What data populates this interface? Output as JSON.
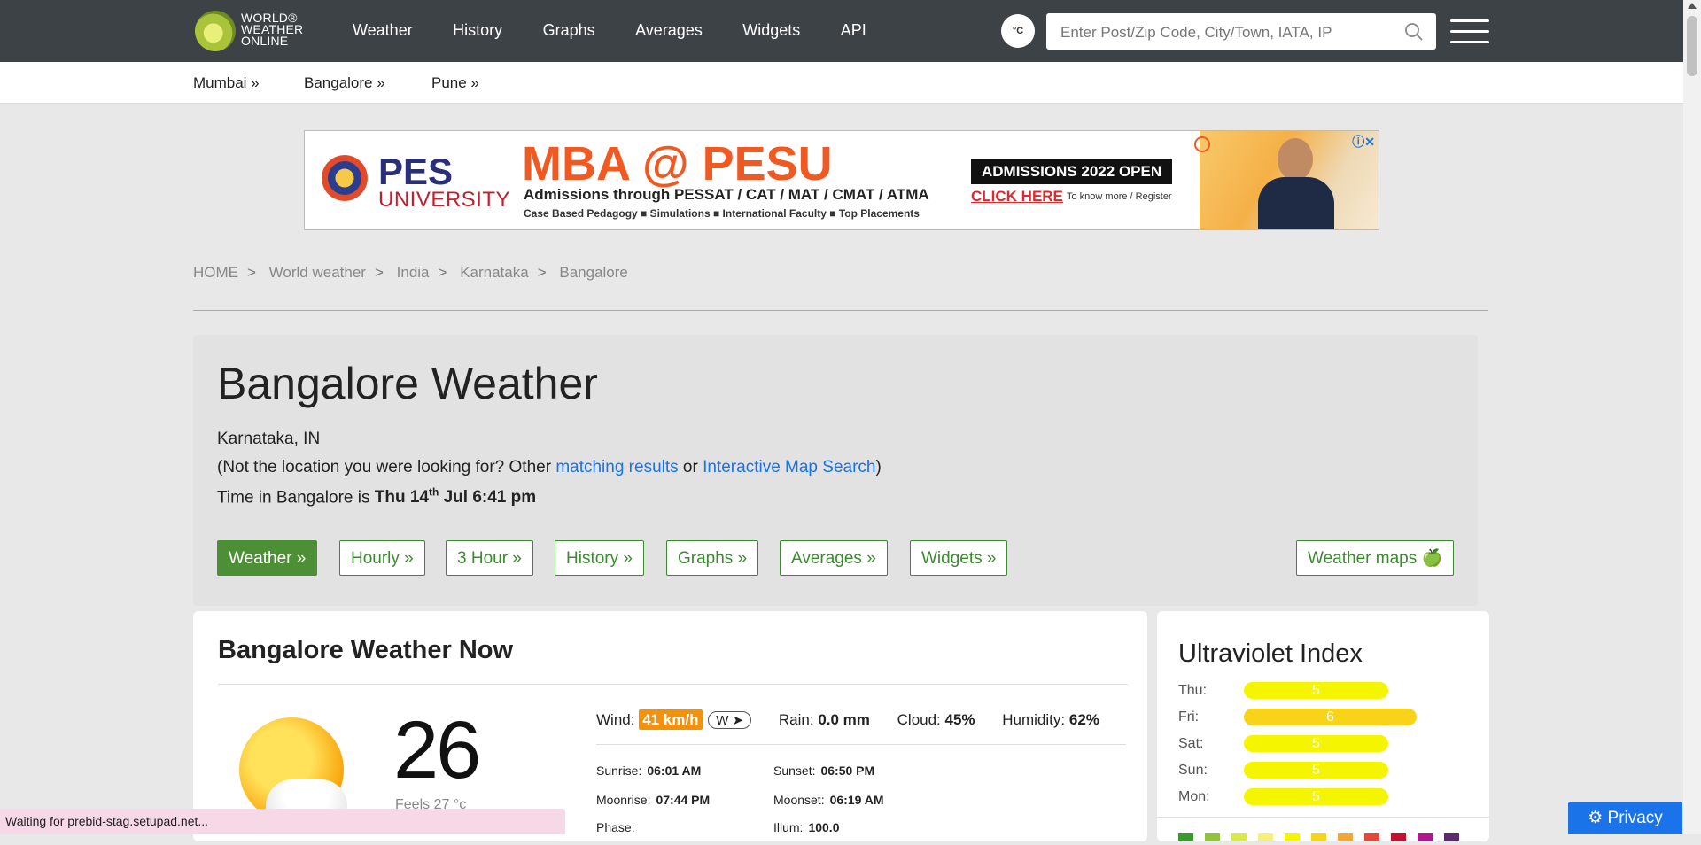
{
  "topbar": {
    "logo_lines": [
      "WORLD®",
      "WEATHER",
      "ONLINE"
    ],
    "nav": [
      "Weather",
      "History",
      "Graphs",
      "Averages",
      "Widgets",
      "API"
    ],
    "unit_label": "°C",
    "search_placeholder": "Enter Post/Zip Code, City/Town, IATA, IP"
  },
  "subnav": [
    "Mumbai »",
    "Bangalore »",
    "Pune »"
  ],
  "ad": {
    "brand": "PES",
    "brand_sub": "UNIVERSITY",
    "headline": "MBA @ PESU",
    "admissions": "Admissions through PESSAT / CAT / MAT / CMAT / ATMA",
    "features": "Case Based Pedagogy ■ Simulations ■ International Faculty ■ Top Placements",
    "open": "ADMISSIONS 2022 OPEN",
    "cta": "CLICK HERE",
    "cta_sub": "To know more / Register",
    "close": "ⓘ✕"
  },
  "breadcrumb": [
    "HOME",
    "World weather",
    "India",
    "Karnataka",
    "Bangalore"
  ],
  "header": {
    "title": "Bangalore Weather",
    "location": "Karnataka, IN",
    "not_location_prefix": "(Not the location you were looking for? Other ",
    "matching_link": "matching results",
    "or": " or ",
    "map_link": "Interactive Map Search",
    "close_paren": ")",
    "time_prefix": "Time in Bangalore is ",
    "time_day": "Thu 14",
    "time_sup": "th",
    "time_rest": " Jul 6:41 pm"
  },
  "tabs": [
    "Weather »",
    "Hourly »",
    "3 Hour »",
    "History »",
    "Graphs »",
    "Averages »",
    "Widgets »"
  ],
  "weather_maps_label": "Weather maps 🍏",
  "now": {
    "title": "Bangalore Weather Now",
    "temp": "26",
    "feels": "Feels 27 °c",
    "wind_label": "Wind:",
    "wind_speed": "41 km/h",
    "wind_dir": "W ➤",
    "rain_label": "Rain:",
    "rain": "0.0 mm",
    "cloud_label": "Cloud:",
    "cloud": "45%",
    "humidity_label": "Humidity:",
    "humidity": "62%",
    "sunrise_label": "Sunrise:",
    "sunrise": "06:01 AM",
    "sunset_label": "Sunset:",
    "sunset": "06:50 PM",
    "moonrise_label": "Moonrise:",
    "moonrise": "07:44 PM",
    "moonset_label": "Moonset:",
    "moonset": "06:19 AM",
    "phase_label": "Phase:",
    "illum_label": "Illum:",
    "illum": "100.0"
  },
  "uv": {
    "title": "Ultraviolet Index",
    "rows": [
      {
        "day": "Thu:",
        "value": "5",
        "color": "#f5f500"
      },
      {
        "day": "Fri:",
        "value": "6",
        "color": "#f9d31a"
      },
      {
        "day": "Sat:",
        "value": "5",
        "color": "#f5f500"
      },
      {
        "day": "Sun:",
        "value": "5",
        "color": "#f5f500"
      },
      {
        "day": "Mon:",
        "value": "5",
        "color": "#f5f500"
      }
    ],
    "scale_colors": [
      "#3a9b2a",
      "#8fc43b",
      "#d8e94a",
      "#f5f07a",
      "#f5f500",
      "#f9d31a",
      "#f3a43a",
      "#e8463a",
      "#c8102e",
      "#b5168f",
      "#5c2a6e"
    ]
  },
  "status_text": "Waiting for prebid-stag.setupad.net...",
  "privacy_label": "Privacy"
}
